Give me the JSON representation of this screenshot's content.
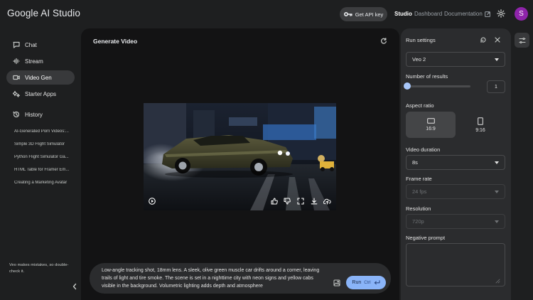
{
  "app": {
    "brand": "Google AI Studio"
  },
  "header": {
    "api_key_label": "Get API key",
    "nav": {
      "studio": "Studio",
      "dashboard": "Dashboard",
      "documentation": "Documentation"
    },
    "avatar_initial": "S"
  },
  "sidebar": {
    "items": [
      {
        "label": "Chat",
        "icon": "chat-icon"
      },
      {
        "label": "Stream",
        "icon": "stream-icon"
      },
      {
        "label": "Video Gen",
        "icon": "video-icon",
        "active": true
      },
      {
        "label": "Starter Apps",
        "icon": "apps-icon"
      }
    ],
    "history_label": "History",
    "history": [
      "AI-Generated Porn Videos:...",
      "Simple 3D Flight Simulator",
      "Python Flight Simulator Ga...",
      "HTML Table for Framer Em...",
      "Creating a Marketing Avatar"
    ],
    "disclaimer": "Veo makes mistakes, so double-check it."
  },
  "main": {
    "title": "Generate Video",
    "prompt": "Low-angle tracking shot, 18mm lens. A sleek, olive green muscle car drifts around a corner, leaving trails of light and tire smoke. The scene is set in a nighttime city with neon signs and yellow cabs visible in the background. Volumetric lighting adds depth and atmosphere",
    "run_label": "Run",
    "run_shortcut": "Ctrl"
  },
  "settings": {
    "title": "Run settings",
    "model": "Veo 2",
    "num_results_label": "Number of results",
    "num_results_value": "1",
    "num_results_slider_fraction": 0.0,
    "aspect_ratio_label": "Aspect ratio",
    "aspect_ratios": [
      {
        "label": "16:9",
        "active": true
      },
      {
        "label": "9:16",
        "active": false
      }
    ],
    "duration_label": "Video duration",
    "duration_value": "8s",
    "frame_rate_label": "Frame rate",
    "frame_rate_value": "24 fps",
    "resolution_label": "Resolution",
    "resolution_value": "720p",
    "negative_prompt_label": "Negative prompt"
  },
  "colors": {
    "accent": "#8ab4f8",
    "avatar": "#8e24aa",
    "background": "#1e1f20"
  }
}
